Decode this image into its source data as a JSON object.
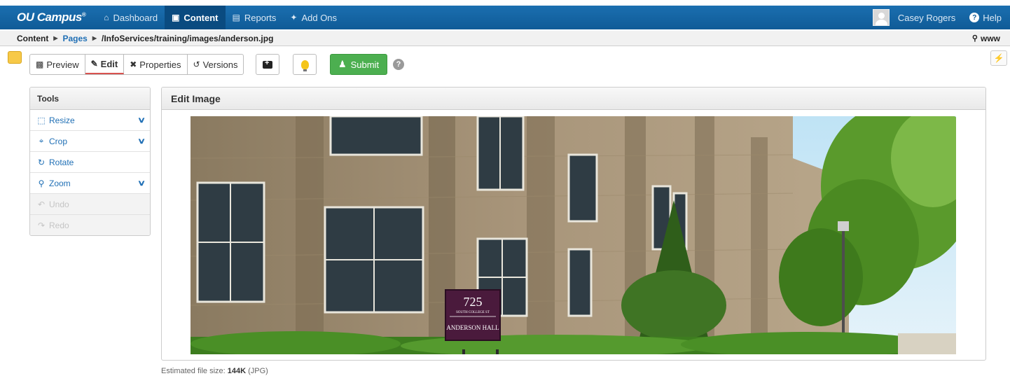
{
  "nav": {
    "logo": "OU Campus",
    "items": [
      {
        "label": "Dashboard",
        "icon": "home-icon"
      },
      {
        "label": "Content",
        "icon": "folder-icon",
        "active": true
      },
      {
        "label": "Reports",
        "icon": "clipboard-icon"
      },
      {
        "label": "Add Ons",
        "icon": "pin-icon"
      }
    ],
    "user": "Casey Rogers",
    "help": "Help"
  },
  "breadcrumb": {
    "items": [
      "Content",
      "Pages",
      "/InfoServices/training/images/anderson.jpg"
    ],
    "site": "www"
  },
  "toolbar": {
    "buttons": [
      {
        "label": "Preview",
        "icon": "monitor-icon"
      },
      {
        "label": "Edit",
        "icon": "pencil-icon",
        "active": true
      },
      {
        "label": "Properties",
        "icon": "tools-icon"
      },
      {
        "label": "Versions",
        "icon": "history-icon"
      }
    ],
    "submit_label": "Submit"
  },
  "tools": {
    "title": "Tools",
    "items": [
      {
        "label": "Resize",
        "icon": "resize-icon",
        "expandable": true,
        "enabled": true
      },
      {
        "label": "Crop",
        "icon": "crop-icon",
        "expandable": true,
        "enabled": true
      },
      {
        "label": "Rotate",
        "icon": "rotate-icon",
        "expandable": false,
        "enabled": true
      },
      {
        "label": "Zoom",
        "icon": "zoom-icon",
        "expandable": true,
        "enabled": true
      },
      {
        "label": "Undo",
        "icon": "undo-icon",
        "expandable": false,
        "enabled": false
      },
      {
        "label": "Redo",
        "icon": "redo-icon",
        "expandable": false,
        "enabled": false
      }
    ]
  },
  "editor": {
    "title": "Edit Image",
    "sign": {
      "number": "725",
      "street": "SOUTH COLLEGE ST",
      "name": "ANDERSON HALL"
    }
  },
  "footer": {
    "filesize_prefix": "Estimated file size:",
    "filesize_value": "144K",
    "filesize_format": "(JPG)"
  },
  "colors": {
    "nav_blue": "#0f5b97",
    "link_blue": "#1f6fb5",
    "submit_green": "#4caf50",
    "edit_underline": "#d9534f"
  }
}
